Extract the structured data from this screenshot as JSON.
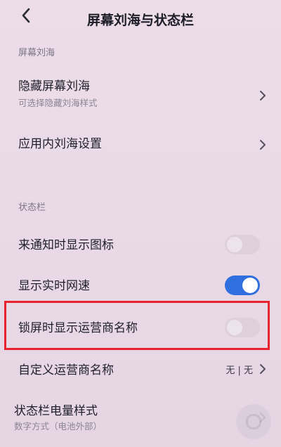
{
  "header": {
    "title": "屏幕刘海与状态栏"
  },
  "sections": [
    {
      "label": "屏幕刘海",
      "items": [
        {
          "title": "隐藏屏幕刘海",
          "subtitle": "可选择隐藏刘海样式"
        },
        {
          "title": "应用内刘海设置"
        }
      ]
    },
    {
      "label": "状态栏",
      "items": [
        {
          "title": "来通知时显示图标",
          "toggle": "off"
        },
        {
          "title": "显示实时网速",
          "toggle": "on"
        },
        {
          "title": "锁屏时显示运营商名称",
          "toggle": "off"
        },
        {
          "title": "自定义运营商名称",
          "value": "无 | 无"
        },
        {
          "title": "状态栏电量样式",
          "subtitle": "数字方式（电池外部）"
        }
      ]
    }
  ],
  "colors": {
    "toggle_on": "#2f6fde",
    "highlight": "#e8232e",
    "background": "#ecdde9"
  },
  "icons": [
    "back-arrow-icon",
    "chevron-right-icon"
  ]
}
